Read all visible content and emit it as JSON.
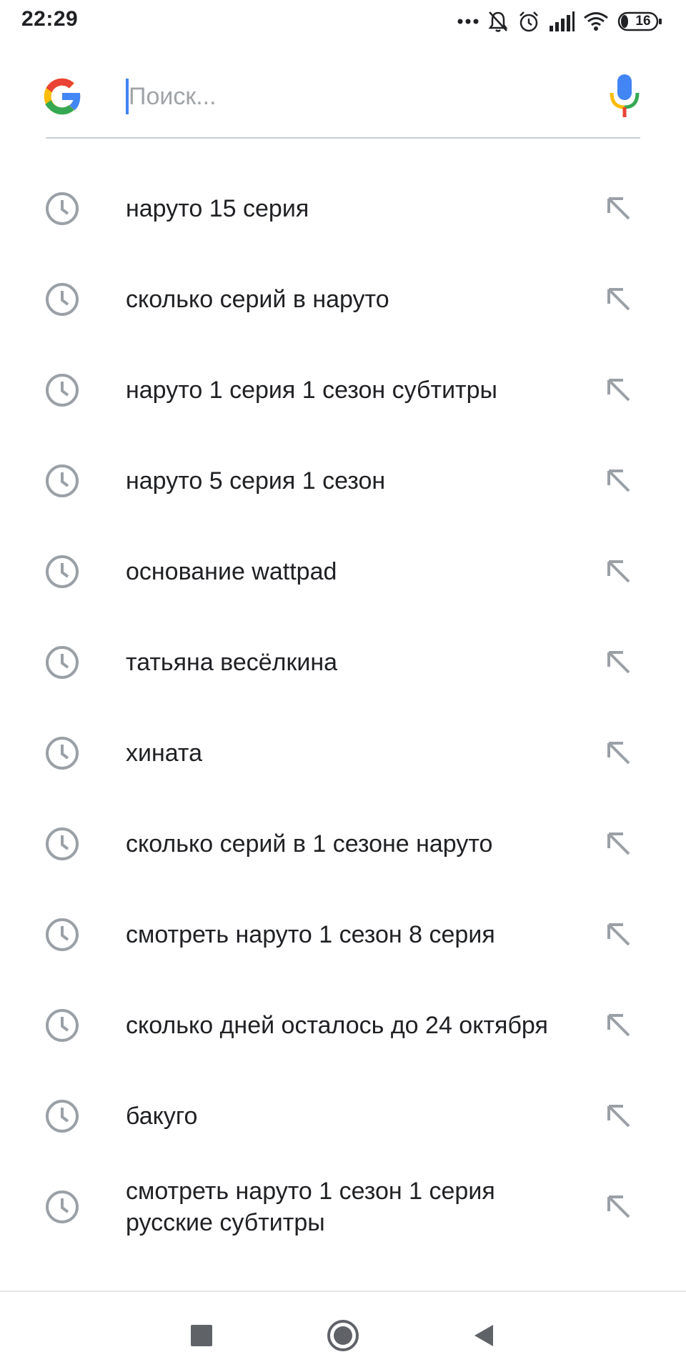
{
  "status_bar": {
    "time": "22:29",
    "battery_level": "16",
    "icons": [
      "more-dots-icon",
      "bell-off-icon",
      "alarm-icon",
      "signal-icon",
      "wifi-icon",
      "battery-icon"
    ]
  },
  "search": {
    "placeholder": "Поиск...",
    "value": "",
    "logo_icon": "google-g-icon",
    "mic_icon": "microphone-icon"
  },
  "suggestions": [
    {
      "text": "наруто 15 серия"
    },
    {
      "text": "сколько серий в наруто"
    },
    {
      "text": "наруто 1 серия 1 сезон субтитры"
    },
    {
      "text": "наруто 5 серия 1 сезон"
    },
    {
      "text": "основание wattpad"
    },
    {
      "text": "татьяна весёлкина"
    },
    {
      "text": "хината"
    },
    {
      "text": "сколько серий в 1 сезоне наруто"
    },
    {
      "text": "смотреть наруто 1 сезон 8 серия"
    },
    {
      "text": "сколько дней осталось до 24 октября"
    },
    {
      "text": "бакуго"
    },
    {
      "text": "смотреть наруто 1 сезон 1 серия русские субтитры"
    }
  ],
  "suggestion_icons": {
    "leading": "history-clock-icon",
    "trailing": "fill-query-arrow-icon"
  },
  "nav_bar": {
    "buttons": [
      "recents-square-icon",
      "home-circle-icon",
      "back-triangle-icon"
    ]
  },
  "colors": {
    "google_blue": "#4285F4",
    "google_red": "#EA4335",
    "google_yellow": "#FBBC05",
    "google_green": "#34A853",
    "text_primary": "#202124",
    "icon_gray": "#9aa0a6"
  }
}
